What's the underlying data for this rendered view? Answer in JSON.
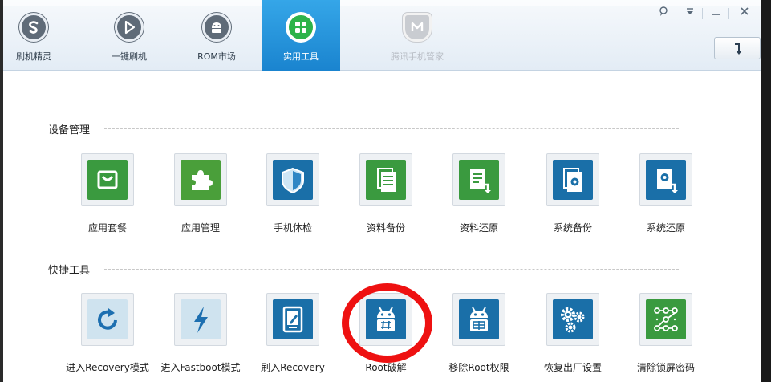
{
  "nav": [
    {
      "label": "刷机精灵",
      "icon": "shuaji-logo-icon"
    },
    {
      "label": "一键刷机",
      "icon": "play-icon"
    },
    {
      "label": "ROM市场",
      "icon": "android-icon"
    },
    {
      "label": "实用工具",
      "icon": "grid-icon"
    },
    {
      "label": "腾讯手机管家",
      "icon": "tencent-shield-icon"
    }
  ],
  "colors": {
    "active_tab": "#1a84cf",
    "tile_blue": "#1a6fa8",
    "tile_green": "#3a9a3f",
    "tile_light": "#cfe3ef",
    "highlight_circle": "#ee1111"
  },
  "sections": [
    {
      "title": "设备管理",
      "tools": [
        {
          "label": "应用套餐",
          "icon": "app-bundle-icon"
        },
        {
          "label": "应用管理",
          "icon": "puzzle-icon"
        },
        {
          "label": "手机体检",
          "icon": "shield-check-icon"
        },
        {
          "label": "资料备份",
          "icon": "document-backup-icon"
        },
        {
          "label": "资料还原",
          "icon": "document-restore-icon"
        },
        {
          "label": "系统备份",
          "icon": "system-backup-icon"
        },
        {
          "label": "系统还原",
          "icon": "system-restore-icon"
        }
      ]
    },
    {
      "title": "快捷工具",
      "tools": [
        {
          "label": "进入Recovery模式",
          "icon": "refresh-icon"
        },
        {
          "label": "进入Fastboot模式",
          "icon": "lightning-icon"
        },
        {
          "label": "刷入Recovery",
          "icon": "tablet-edit-icon"
        },
        {
          "label": "Root破解",
          "icon": "android-root-icon"
        },
        {
          "label": "移除Root权限",
          "icon": "android-unroot-icon"
        },
        {
          "label": "恢复出厂设置",
          "icon": "gears-icon"
        },
        {
          "label": "清除锁屏密码",
          "icon": "pattern-lock-icon"
        }
      ]
    }
  ]
}
